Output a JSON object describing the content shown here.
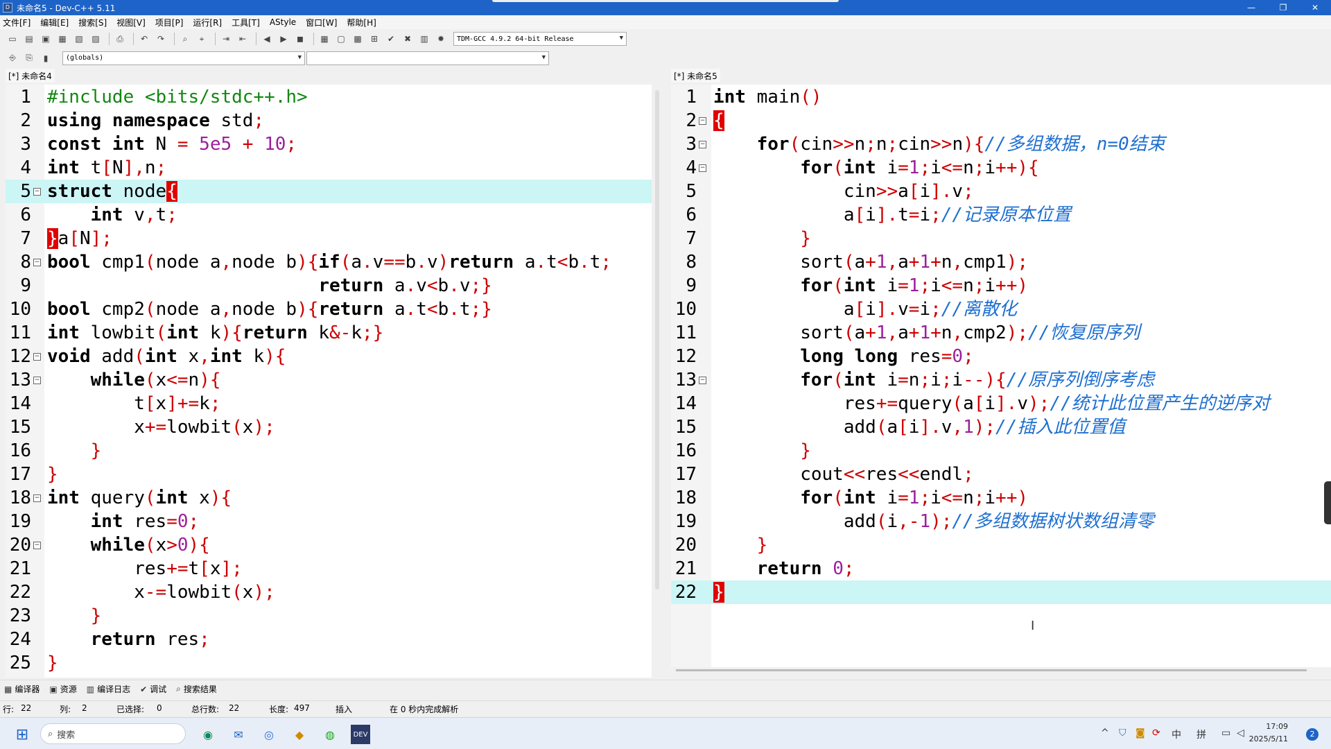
{
  "window": {
    "title": "未命名5 - Dev-C++ 5.11",
    "buttons": [
      "—",
      "❐",
      "✕"
    ]
  },
  "menu": [
    "文件[F]",
    "编辑[E]",
    "搜索[S]",
    "视图[V]",
    "项目[P]",
    "运行[R]",
    "工具[T]",
    "AStyle",
    "窗口[W]",
    "帮助[H]"
  ],
  "toolbar": {
    "compiler_select": "TDM-GCC 4.9.2 64-bit Release",
    "scope_select": "(globals)",
    "member_select": ""
  },
  "tabs": {
    "left": "[*] 未命名4",
    "right": "[*] 未命名5"
  },
  "left_code": [
    "<span class=\"pp\">#include &lt;bits/stdc++.h&gt;</span>",
    "<span class=\"kw\">using namespace</span> std<span class=\"op\">;</span>",
    "<span class=\"kw\">const int</span> N <span class=\"op\">=</span> <span class=\"num\">5e5</span> <span class=\"op\">+</span> <span class=\"num\">10</span><span class=\"op\">;</span>",
    "<span class=\"kw\">int</span> t<span class=\"op\">[</span>N<span class=\"op\">],</span>n<span class=\"op\">;</span>",
    "<span class=\"kw\">struct</span> node<span class=\"br\">{</span>",
    "    <span class=\"kw\">int</span> v<span class=\"op\">,</span>t<span class=\"op\">;</span>",
    "<span class=\"br\">}</span>a<span class=\"op\">[</span>N<span class=\"op\">];</span>",
    "<span class=\"kw\">bool</span> cmp1<span class=\"op\">(</span>node a<span class=\"op\">,</span>node b<span class=\"op\">){</span><span class=\"kw\">if</span><span class=\"op\">(</span>a<span class=\"op\">.</span>v<span class=\"op\">==</span>b<span class=\"op\">.</span>v<span class=\"op\">)</span><span class=\"kw\">return</span> a<span class=\"op\">.</span>t<span class=\"op\">&lt;</span>b<span class=\"op\">.</span>t<span class=\"op\">;</span>",
    "                         <span class=\"kw\">return</span> a<span class=\"op\">.</span>v<span class=\"op\">&lt;</span>b<span class=\"op\">.</span>v<span class=\"op\">;}</span>",
    "<span class=\"kw\">bool</span> cmp2<span class=\"op\">(</span>node a<span class=\"op\">,</span>node b<span class=\"op\">){</span><span class=\"kw\">return</span> a<span class=\"op\">.</span>t<span class=\"op\">&lt;</span>b<span class=\"op\">.</span>t<span class=\"op\">;}</span>",
    "<span class=\"kw\">int</span> lowbit<span class=\"op\">(</span><span class=\"kw\">int</span> k<span class=\"op\">){</span><span class=\"kw\">return</span> k<span class=\"op\">&amp;-</span>k<span class=\"op\">;}</span>",
    "<span class=\"kw\">void</span> add<span class=\"op\">(</span><span class=\"kw\">int</span> x<span class=\"op\">,</span><span class=\"kw\">int</span> k<span class=\"op\">){</span>",
    "    <span class=\"kw\">while</span><span class=\"op\">(</span>x<span class=\"op\">&lt;=</span>n<span class=\"op\">){</span>",
    "        t<span class=\"op\">[</span>x<span class=\"op\">]+=</span>k<span class=\"op\">;</span>",
    "        x<span class=\"op\">+=</span>lowbit<span class=\"op\">(</span>x<span class=\"op\">);</span>",
    "    <span class=\"op\">}</span>",
    "<span class=\"op\">}</span>",
    "<span class=\"kw\">int</span> query<span class=\"op\">(</span><span class=\"kw\">int</span> x<span class=\"op\">){</span>",
    "    <span class=\"kw\">int</span> res<span class=\"op\">=</span><span class=\"num\">0</span><span class=\"op\">;</span>",
    "    <span class=\"kw\">while</span><span class=\"op\">(</span>x<span class=\"op\">&gt;</span><span class=\"num\">0</span><span class=\"op\">){</span>",
    "        res<span class=\"op\">+=</span>t<span class=\"op\">[</span>x<span class=\"op\">];</span>",
    "        x<span class=\"op\">-=</span>lowbit<span class=\"op\">(</span>x<span class=\"op\">);</span>",
    "    <span class=\"op\">}</span>",
    "    <span class=\"kw\">return</span> res<span class=\"op\">;</span>",
    "<span class=\"op\">}</span>"
  ],
  "right_code": [
    "<span class=\"kw\">int</span> main<span class=\"op\">()</span>",
    "<span class=\"br\">{</span>",
    "    <span class=\"kw\">for</span><span class=\"op\">(</span>cin<span class=\"op\">&gt;&gt;</span>n<span class=\"op\">;</span>n<span class=\"op\">;</span>cin<span class=\"op\">&gt;&gt;</span>n<span class=\"op\">){</span><span class=\"cm\">//多组数据，n=0结束</span>",
    "        <span class=\"kw\">for</span><span class=\"op\">(</span><span class=\"kw\">int</span> i<span class=\"op\">=</span><span class=\"num\">1</span><span class=\"op\">;</span>i<span class=\"op\">&lt;=</span>n<span class=\"op\">;</span>i<span class=\"op\">++){</span>",
    "            cin<span class=\"op\">&gt;&gt;</span>a<span class=\"op\">[</span>i<span class=\"op\">].</span>v<span class=\"op\">;</span>",
    "            a<span class=\"op\">[</span>i<span class=\"op\">].</span>t<span class=\"op\">=</span>i<span class=\"op\">;</span><span class=\"cm\">//记录原本位置</span>",
    "        <span class=\"op\">}</span>",
    "        sort<span class=\"op\">(</span>a<span class=\"op\">+</span><span class=\"num\">1</span><span class=\"op\">,</span>a<span class=\"op\">+</span><span class=\"num\">1</span><span class=\"op\">+</span>n<span class=\"op\">,</span>cmp1<span class=\"op\">);</span>",
    "        <span class=\"kw\">for</span><span class=\"op\">(</span><span class=\"kw\">int</span> i<span class=\"op\">=</span><span class=\"num\">1</span><span class=\"op\">;</span>i<span class=\"op\">&lt;=</span>n<span class=\"op\">;</span>i<span class=\"op\">++)</span>",
    "            a<span class=\"op\">[</span>i<span class=\"op\">].</span>v<span class=\"op\">=</span>i<span class=\"op\">;</span><span class=\"cm\">//离散化</span>",
    "        sort<span class=\"op\">(</span>a<span class=\"op\">+</span><span class=\"num\">1</span><span class=\"op\">,</span>a<span class=\"op\">+</span><span class=\"num\">1</span><span class=\"op\">+</span>n<span class=\"op\">,</span>cmp2<span class=\"op\">);</span><span class=\"cm\">//恢复原序列</span>",
    "        <span class=\"kw\">long long</span> res<span class=\"op\">=</span><span class=\"num\">0</span><span class=\"op\">;</span>",
    "        <span class=\"kw\">for</span><span class=\"op\">(</span><span class=\"kw\">int</span> i<span class=\"op\">=</span>n<span class=\"op\">;</span>i<span class=\"op\">;</span>i<span class=\"op\">--){</span><span class=\"cm\">//原序列倒序考虑</span>",
    "            res<span class=\"op\">+=</span>query<span class=\"op\">(</span>a<span class=\"op\">[</span>i<span class=\"op\">].</span>v<span class=\"op\">);</span><span class=\"cm\">//统计此位置产生的逆序对</span>",
    "            add<span class=\"op\">(</span>a<span class=\"op\">[</span>i<span class=\"op\">].</span>v<span class=\"op\">,</span><span class=\"num\">1</span><span class=\"op\">);</span><span class=\"cm\">//插入此位置值</span>",
    "        <span class=\"op\">}</span>",
    "        cout<span class=\"op\">&lt;&lt;</span>res<span class=\"op\">&lt;&lt;</span>endl<span class=\"op\">;</span>",
    "        <span class=\"kw\">for</span><span class=\"op\">(</span><span class=\"kw\">int</span> i<span class=\"op\">=</span><span class=\"num\">1</span><span class=\"op\">;</span>i<span class=\"op\">&lt;=</span>n<span class=\"op\">;</span>i<span class=\"op\">++)</span>",
    "            add<span class=\"op\">(</span>i<span class=\"op\">,-</span><span class=\"num\">1</span><span class=\"op\">);</span><span class=\"cm\">//多组数据树状数组清零</span>",
    "    <span class=\"op\">}</span>",
    "    <span class=\"kw\">return</span> <span class=\"num\">0</span><span class=\"op\">;</span>",
    "<span class=\"br\">}</span>"
  ],
  "left_folds": [
    5,
    8,
    12,
    13,
    18,
    20
  ],
  "right_folds": [
    2,
    3,
    4,
    13
  ],
  "left_highlight_line": 5,
  "right_highlight_line": 22,
  "panel_tabs": [
    "编译器",
    "资源",
    "编译日志",
    "调试",
    "搜索结果"
  ],
  "status": {
    "row_label": "行:",
    "row": "22",
    "col_label": "列:",
    "col": "2",
    "sel_label": "已选择:",
    "sel": "0",
    "lines_label": "总行数:",
    "lines": "22",
    "len_label": "长度:",
    "len": "497",
    "mode": "插入",
    "parse": "在 0 秒内完成解析"
  },
  "taskbar": {
    "search_placeholder": "搜索",
    "tray": [
      "^",
      "中",
      "拼"
    ],
    "time": "17:09",
    "date": "2025/5/11",
    "badge": "2"
  }
}
